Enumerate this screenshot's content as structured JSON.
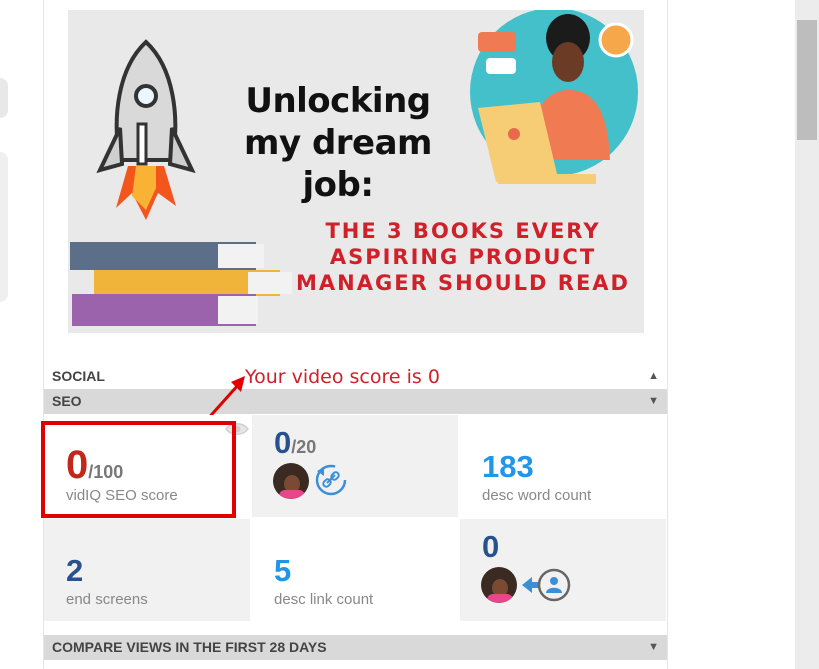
{
  "thumbnail": {
    "title": "Unlocking my dream job:",
    "subtitle": "THE 3 BOOKS EVERY ASPIRING PRODUCT MANAGER SHOULD READ"
  },
  "sections": {
    "social": "SOCIAL",
    "seo": "SEO",
    "compare": "COMPARE VIEWS IN THE FIRST 28 DAYS"
  },
  "annotation": "Your video score is 0",
  "stats": {
    "seo_score": {
      "value": "0",
      "max": "/100",
      "label": "vidIQ SEO score"
    },
    "tag_score": {
      "value": "0",
      "max": "/20"
    },
    "desc_words": {
      "value": "183",
      "label": "desc word count"
    },
    "end_screens": {
      "value": "2",
      "label": "end screens"
    },
    "desc_links": {
      "value": "5",
      "label": "desc link count"
    },
    "cards": {
      "value": "0"
    }
  },
  "icons": {
    "collapse": "triangle-up-icon",
    "expand": "triangle-down-icon",
    "link": "link-refresh-icon",
    "subscribe": "subscribe-arrow-icon",
    "eye": "eye-icon"
  },
  "colors": {
    "score_red": "#c0291a",
    "value_blue": "#27528d",
    "value_light_blue": "#2196e8",
    "annotation_red": "#d0202a"
  }
}
